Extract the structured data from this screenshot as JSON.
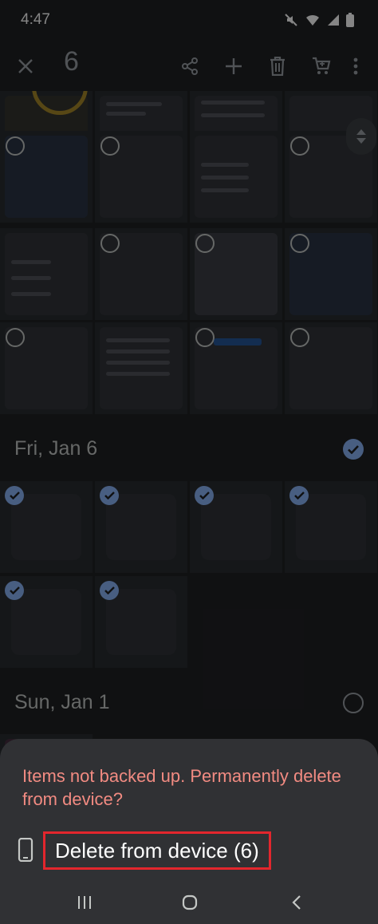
{
  "status_bar": {
    "time": "4:47",
    "icons": [
      "mute-icon",
      "wifi-icon",
      "signal-icon",
      "battery-icon"
    ]
  },
  "app_bar": {
    "selected_count": "6",
    "actions": [
      "close-icon",
      "share-icon",
      "add-icon",
      "delete-icon",
      "shopping-cart-icon",
      "more-vert-icon"
    ]
  },
  "sections": [
    {
      "date": "Fri, Jan 6",
      "selected": true
    },
    {
      "date": "Sun, Jan 1",
      "selected": false
    }
  ],
  "bottom_sheet": {
    "message": "Items not backed up. Permanently delete from device?",
    "action_label": "Delete from device (6)",
    "action_icon": "phone-icon"
  },
  "nav_bar": {
    "buttons": [
      "recent-apps-icon",
      "home-icon",
      "back-icon"
    ]
  },
  "colors": {
    "accent": "#8ab4f8",
    "warning_text": "#f28b82",
    "highlight_box": "#e3262d",
    "sheet_bg": "#303134"
  }
}
